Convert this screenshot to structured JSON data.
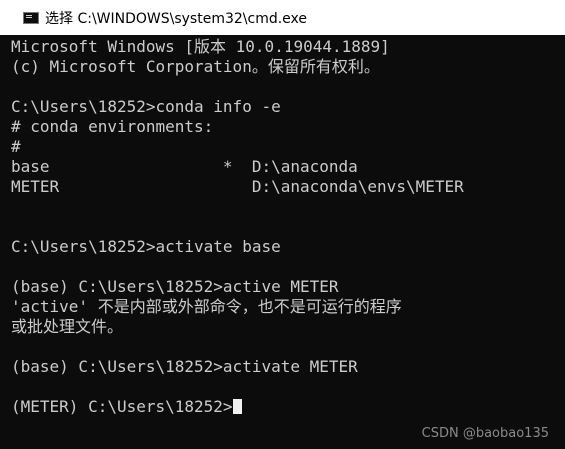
{
  "window": {
    "title": "选择 C:\\WINDOWS\\system32\\cmd.exe",
    "icon": "cmd-icon"
  },
  "console": {
    "lines": [
      "Microsoft Windows [版本 10.0.19044.1889]",
      "(c) Microsoft Corporation。保留所有权利。",
      "",
      "C:\\Users\\18252>conda info -e",
      "# conda environments:",
      "#",
      "base                  *  D:\\anaconda",
      "METER                    D:\\anaconda\\envs\\METER",
      "",
      "",
      "C:\\Users\\18252>activate base",
      "",
      "(base) C:\\Users\\18252>active METER",
      "'active' 不是内部或外部命令，也不是可运行的程序",
      "或批处理文件。",
      "",
      "(base) C:\\Users\\18252>activate METER",
      "",
      "(METER) C:\\Users\\18252>"
    ]
  },
  "watermark": "CSDN @baobao135",
  "colors": {
    "console_bg": "#0c0c0c",
    "console_fg": "#cccccc",
    "titlebar_bg": "#ffffff"
  }
}
